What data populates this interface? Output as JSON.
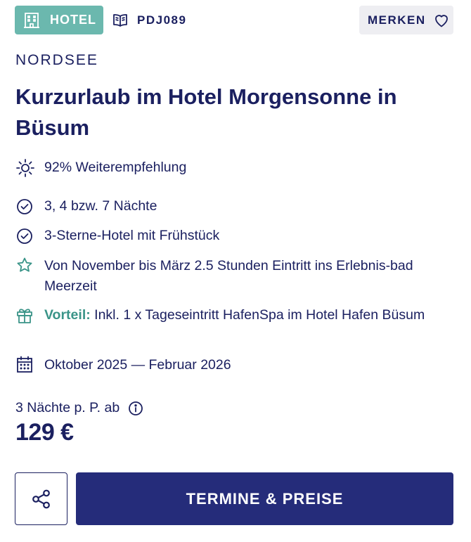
{
  "header": {
    "category_label": "HOTEL",
    "category_icon": "hotel-icon",
    "code_icon": "book-icon",
    "code": "PDJ089",
    "merken_label": "MERKEN",
    "merken_icon": "heart-icon"
  },
  "region": "NORDSEE",
  "title": "Kurzurlaub im Hotel Morgensonne in Büsum",
  "features": [
    {
      "icon": "sun-icon",
      "text": "92% Weiterempfehlung"
    },
    {
      "icon": "check-circle-icon",
      "text": "3, 4 bzw. 7 Nächte"
    },
    {
      "icon": "check-circle-icon",
      "text": "3-Sterne-Hotel mit Frühstück"
    },
    {
      "icon": "star-icon",
      "text": "Von November bis März 2.5 Stunden Eintritt ins Erlebnis-bad Meerzeit"
    },
    {
      "icon": "gift-icon",
      "highlight": "Vorteil:",
      "text": " Inkl. 1 x Tageseintritt HafenSpa im Hotel Hafen Büsum"
    },
    {
      "icon": "calendar-icon",
      "text": "Oktober 2025 — Februar 2026"
    }
  ],
  "pricing": {
    "label": "3 Nächte p. P. ab",
    "info_icon": "info-icon",
    "price": "129 €"
  },
  "actions": {
    "share_icon": "share-icon",
    "primary_label": "TERMINE & PREISE"
  },
  "colors": {
    "navy": "#1b2060",
    "teal": "#6bb8ae",
    "teal_text": "#3a9488",
    "button": "#252c7a",
    "merken_bg": "#eeeef2"
  }
}
